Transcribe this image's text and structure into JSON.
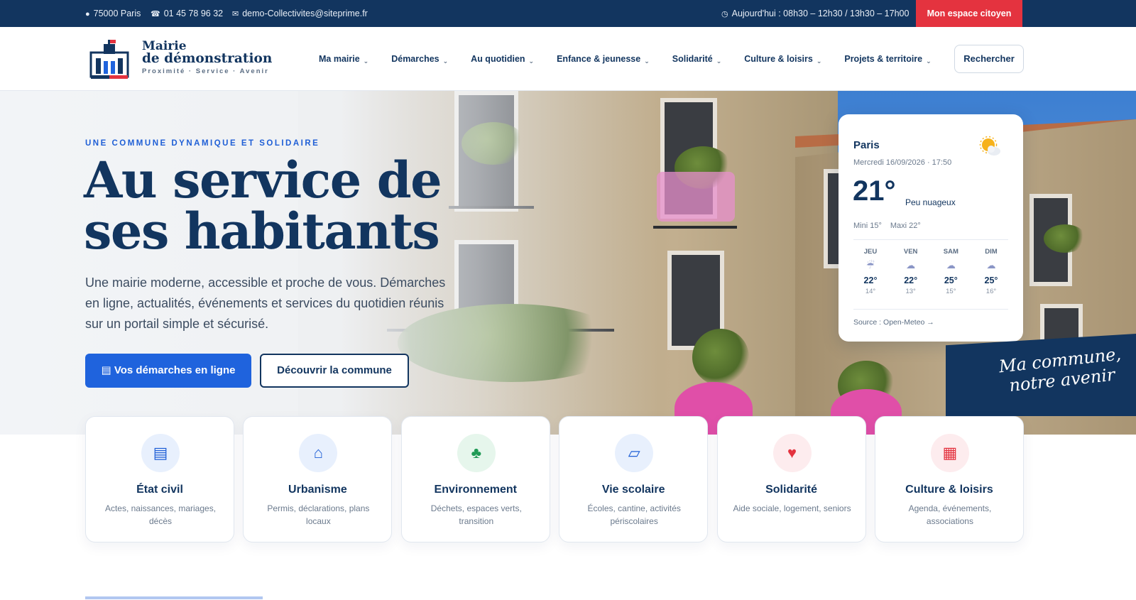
{
  "topbar": {
    "location": "75000 Paris",
    "phone": "01 45 78 96 32",
    "email": "demo-Collectivites@siteprime.fr",
    "hours": "Aujourd'hui : 08h30 – 12h30 / 13h30 – 17h00",
    "citizen_button": "Mon espace citoyen"
  },
  "brand": {
    "line1": "Mairie",
    "line2": "de démonstration",
    "tagline": "Proximité · Service · Avenir"
  },
  "nav": {
    "items": [
      "Ma mairie",
      "Démarches",
      "Au quotidien",
      "Enfance & jeunesse",
      "Solidarité",
      "Culture & loisirs",
      "Projets & territoire"
    ],
    "search_label": "Rechercher"
  },
  "hero": {
    "eyebrow": "UNE COMMUNE DYNAMIQUE ET SOLIDAIRE",
    "title_line1": "Au service de",
    "title_line2": "ses habitants",
    "text": "Une mairie moderne, accessible et proche de vous. Démarches en ligne, actualités, événements et services du quotidien réunis sur un portail simple et sécurisé.",
    "primary_button": "Vos démarches en ligne",
    "secondary_button": "Découvrir la commune"
  },
  "weather": {
    "city": "Paris",
    "date": "Mercredi 16/09/2026 · 17:50",
    "temperature": "21°",
    "condition": "Peu nuageux",
    "min": "Mini 15°",
    "max": "Maxi 22°",
    "icon": "partly-cloudy-icon",
    "forecast": [
      {
        "day": "JEU",
        "max": "22°",
        "min": "14°",
        "icon": "rain-icon"
      },
      {
        "day": "VEN",
        "max": "22°",
        "min": "13°",
        "icon": "cloud-icon"
      },
      {
        "day": "SAM",
        "max": "25°",
        "min": "15°",
        "icon": "cloud-icon"
      },
      {
        "day": "DIM",
        "max": "25°",
        "min": "16°",
        "icon": "cloud-icon"
      }
    ],
    "source": "Source : Open-Meteo →"
  },
  "slogan": {
    "line1": "Ma commune,",
    "line2": "notre avenir"
  },
  "services": [
    {
      "title": "État civil",
      "desc": "Actes, naissances, mariages, décès",
      "icon": "document-list-icon",
      "color": "#1f5fd6",
      "bg": "#e8f0fd"
    },
    {
      "title": "Urbanisme",
      "desc": "Permis, déclarations, plans locaux",
      "icon": "house-icon",
      "color": "#1f5fd6",
      "bg": "#e8f0fd"
    },
    {
      "title": "Environnement",
      "desc": "Déchets, espaces verts, transition",
      "icon": "tree-icon",
      "color": "#1f9a55",
      "bg": "#e6f6ec"
    },
    {
      "title": "Vie scolaire",
      "desc": "Écoles, cantine, activités périscolaires",
      "icon": "book-icon",
      "color": "#1f5fd6",
      "bg": "#e8f0fd"
    },
    {
      "title": "Solidarité",
      "desc": "Aide sociale, logement, seniors",
      "icon": "heart-icon",
      "color": "#e4333f",
      "bg": "#fdecee"
    },
    {
      "title": "Culture & loisirs",
      "desc": "Agenda, événements, associations",
      "icon": "calendar-icon",
      "color": "#e4333f",
      "bg": "#fdecee"
    }
  ],
  "colors": {
    "navy": "#12355f",
    "accent_blue": "#1f63dd",
    "accent_red": "#e4333f"
  }
}
